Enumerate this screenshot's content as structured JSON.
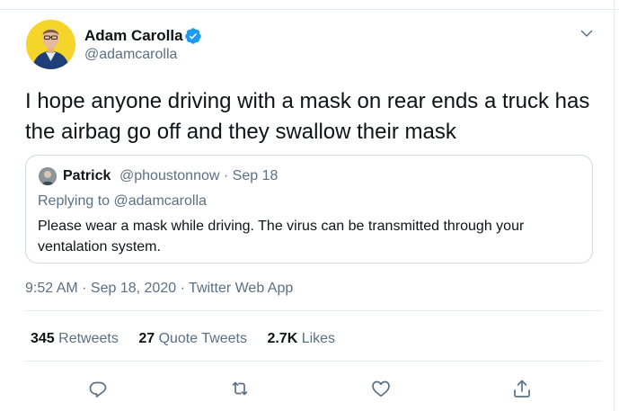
{
  "author": {
    "name": "Adam Carolla",
    "handle": "@adamcarolla",
    "avatar_icon": "profile-photo"
  },
  "tweet": {
    "text": "I hope anyone driving with a mask on rear ends a truck has the airbag go off and they swallow their mask",
    "timestamp": "9:52 AM · Sep 18, 2020 · Twitter Web App"
  },
  "quote": {
    "name": "Patrick",
    "meta": "@phoustonnow · Sep 18",
    "reply_prefix": "Replying to",
    "reply_handle": "@adamcarolla",
    "text": "Please wear a mask while driving.  The virus can be transmitted through your ventalation system."
  },
  "stats": {
    "retweets_count": "345",
    "retweets_label": "Retweets",
    "quotes_count": "27",
    "quotes_label": "Quote Tweets",
    "likes_count": "2.7K",
    "likes_label": "Likes"
  },
  "actions": {
    "icons": [
      "reply-icon",
      "retweet-icon",
      "like-icon",
      "share-icon"
    ]
  },
  "colors": {
    "verified": "#1d9bf0",
    "secondary_text": "#5b7083",
    "border": "#e6ecf0"
  }
}
